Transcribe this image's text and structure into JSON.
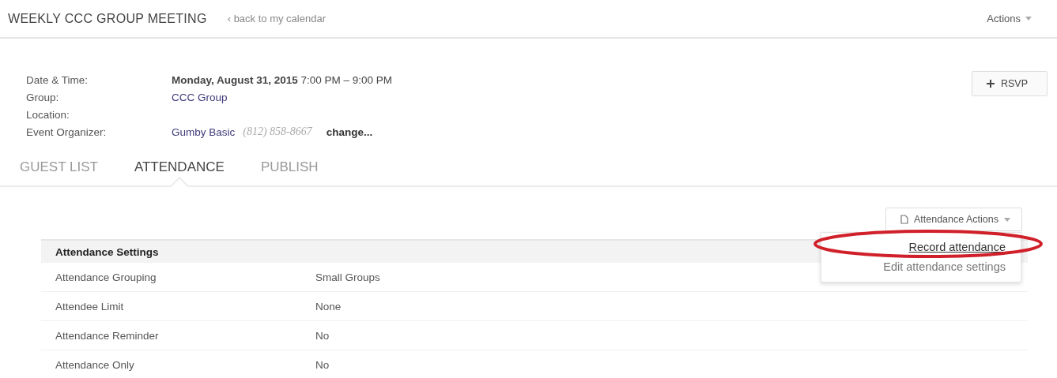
{
  "header": {
    "title": "WEEKLY CCC GROUP MEETING",
    "back_link": "‹ back to my calendar",
    "actions": "Actions"
  },
  "rsvp_button": "RSVP",
  "details": [
    {
      "label": "Date & Time:",
      "parts": [
        {
          "kind": "text",
          "text": "**Monday, August 31, 2015** 7:00 PM – 9:00 PM"
        }
      ]
    },
    {
      "label": "Group:",
      "parts": [
        {
          "kind": "link",
          "text": "CCC Group"
        }
      ]
    },
    {
      "label": "Location:"
    },
    {
      "label": "Event Organizer:",
      "parts": [
        {
          "kind": "link",
          "text": "Gumby Basic"
        },
        {
          "kind": "phone",
          "text": "(812) 858-8667"
        },
        {
          "kind": "action",
          "text": "change..."
        }
      ]
    }
  ],
  "tabs": [
    {
      "label": "GUEST LIST",
      "selected": false
    },
    {
      "label": "ATTENDANCE",
      "selected": true
    },
    {
      "label": "PUBLISH",
      "selected": false
    }
  ],
  "attendance_actions": {
    "label": "Attendance Actions",
    "expanded": true,
    "items": [
      {
        "label": "Record attendance",
        "highlighted": true
      },
      {
        "label": "Edit attendance settings",
        "highlighted": false
      }
    ]
  },
  "settings": {
    "title": "Attendance Settings",
    "rows": [
      {
        "name": "Attendance Grouping",
        "value": "Small Groups"
      },
      {
        "name": "Attendee Limit",
        "value": "None"
      },
      {
        "name": "Attendance Reminder",
        "value": "No"
      },
      {
        "name": "Attendance Only",
        "value": "No"
      }
    ]
  }
}
